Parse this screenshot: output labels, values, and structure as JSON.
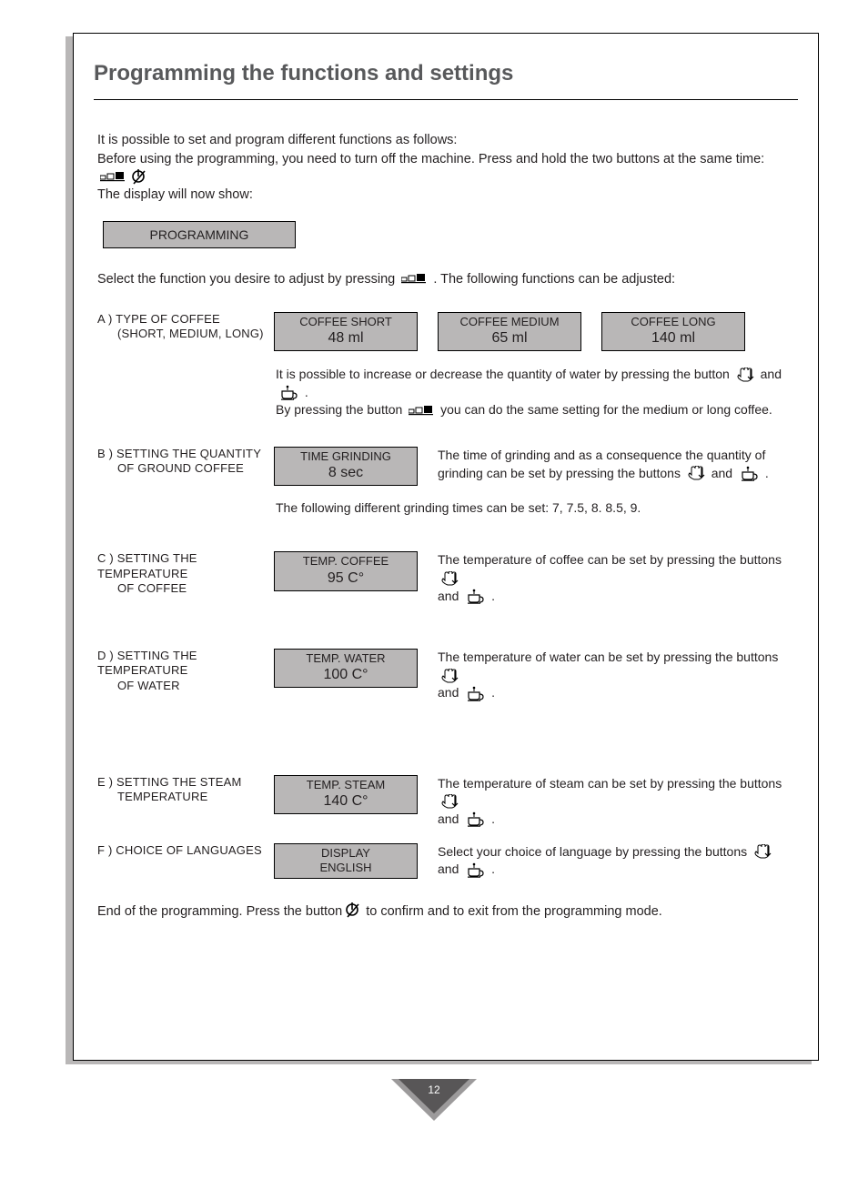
{
  "title": "Programming the functions and settings",
  "intro": {
    "l1": "It is possible to set and program different functions as follows:",
    "l2a": "Before using the programming, you need to turn off the machine.  Press and hold the two buttons at the same time:",
    "l3": "The display will now show:"
  },
  "display_programming": "PROGRAMMING",
  "select_line_a": "Select the function you desire to adjust by pressing",
  "select_line_b": ".  The following functions can be adjusted:",
  "a": {
    "label1": "A )   TYPE OF COFFEE",
    "label2": "(SHORT, MEDIUM, LONG)",
    "box1_t": "COFFEE SHORT",
    "box1_v": "48 ml",
    "box2_t": "COFFEE MEDIUM",
    "box2_v": "65 ml",
    "box3_t": "COFFEE LONG",
    "box3_v": "140 ml",
    "note_a": "It is possible to increase or decrease the quantity of water by pressing the button",
    "note_mid": " and ",
    "note_b": ".",
    "note2_a": "By pressing the button",
    "note2_b": " you can do the same setting for the medium or long coffee."
  },
  "b": {
    "label1": "B )   SETTING THE QUANTITY",
    "label2": "OF GROUND COFFEE",
    "box_t": "TIME GRINDING",
    "box_v": "8 sec",
    "r1": "The time of grinding and as a consequence the quantity of grinding can be set by pressing the buttons",
    "r_mid": " and ",
    "r_end": ".",
    "note": "The following different grinding times can be set: 7, 7.5, 8. 8.5, 9."
  },
  "c": {
    "label1": "C )   SETTING THE TEMPERATURE",
    "label2": "OF COFFEE",
    "box_t": "TEMP. COFFEE",
    "box_v": "95 C°",
    "r1": "The temperature of coffee can be set by pressing the buttons",
    "r_mid": " and ",
    "r_end": "."
  },
  "d": {
    "label1": "D )   SETTING THE TEMPERATURE",
    "label2": "OF WATER",
    "box_t": "TEMP. WATER",
    "box_v": "100 C°",
    "r1": "The temperature of water can be set by pressing the buttons",
    "r_mid": " and ",
    "r_end": "."
  },
  "e": {
    "label1": "E )   SETTING THE STEAM",
    "label2": "TEMPERATURE",
    "box_t": "TEMP. STEAM",
    "box_v": "140 C°",
    "r1": "The temperature of steam can be set by pressing the buttons",
    "r_mid": " and ",
    "r_end": "."
  },
  "f": {
    "label1": "F )   CHOICE OF LANGUAGES",
    "box_t": "DISPLAY",
    "box_v": "ENGLISH",
    "r1": "Select your choice of language by pressing the buttons",
    "r_mid": " and ",
    "r_end": "."
  },
  "end_a": "End of the programming.  Press the button",
  "end_b": " to confirm and to exit from the programming mode.",
  "page_number": "12"
}
